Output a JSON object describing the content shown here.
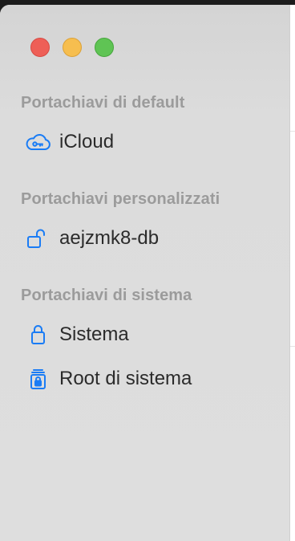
{
  "window": {
    "traffic_lights": [
      "close",
      "minimize",
      "zoom"
    ]
  },
  "sidebar": {
    "sections": [
      {
        "title": "Portachiavi di default",
        "items": [
          {
            "label": "iCloud",
            "icon": "icloud-key-icon"
          }
        ]
      },
      {
        "title": "Portachiavi personalizzati",
        "items": [
          {
            "label": "aejzmk8-db",
            "icon": "unlocked-padlock-icon"
          }
        ]
      },
      {
        "title": "Portachiavi di sistema",
        "items": [
          {
            "label": "Sistema",
            "icon": "locked-padlock-icon"
          },
          {
            "label": "Root di sistema",
            "icon": "system-roots-icon"
          }
        ]
      }
    ]
  },
  "colors": {
    "accent": "#1a7cf5",
    "section_title": "#9b9b9b",
    "item_text": "#2b2b2b"
  }
}
